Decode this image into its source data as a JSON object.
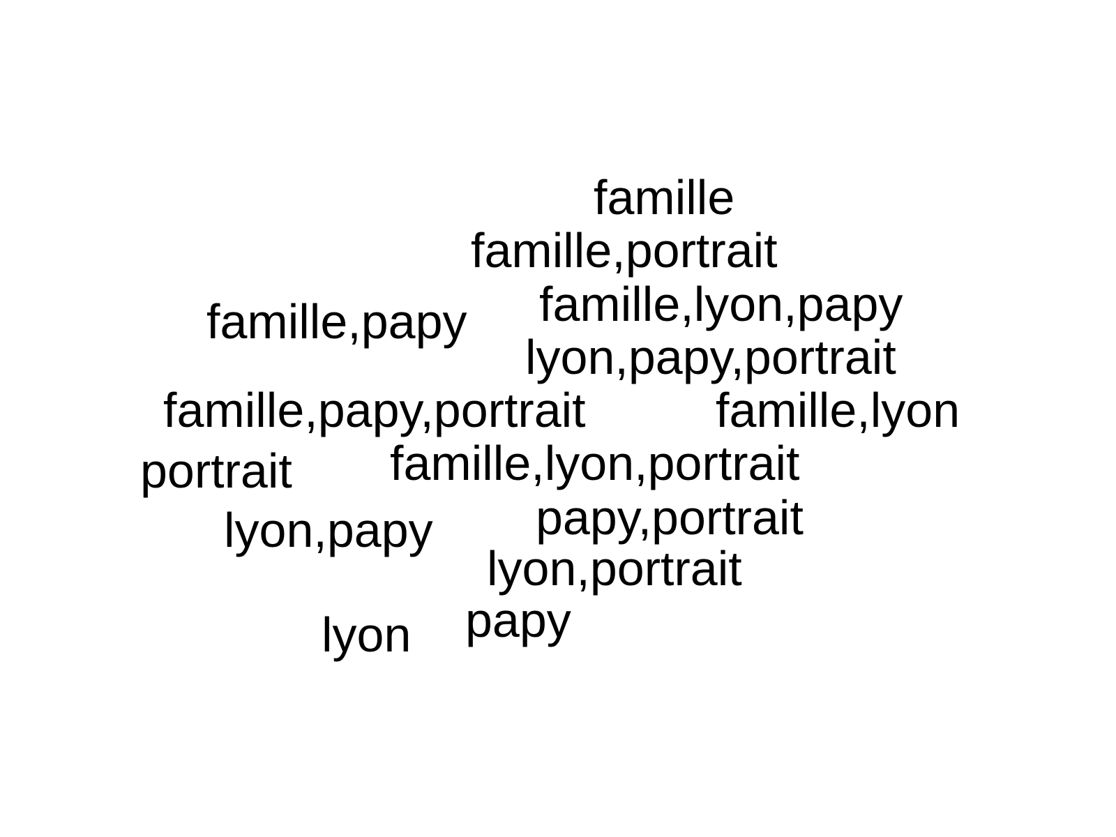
{
  "colors": {
    "background": "#ffffff",
    "text": "#000000"
  },
  "words": [
    "famille",
    "famille,portrait",
    "famille,lyon,papy",
    "famille,papy",
    "lyon,papy,portrait",
    "famille,papy,portrait",
    "famille,lyon",
    "portrait",
    "famille,lyon,portrait",
    "papy,portrait",
    "lyon,papy",
    "lyon,portrait",
    "papy",
    "lyon"
  ]
}
